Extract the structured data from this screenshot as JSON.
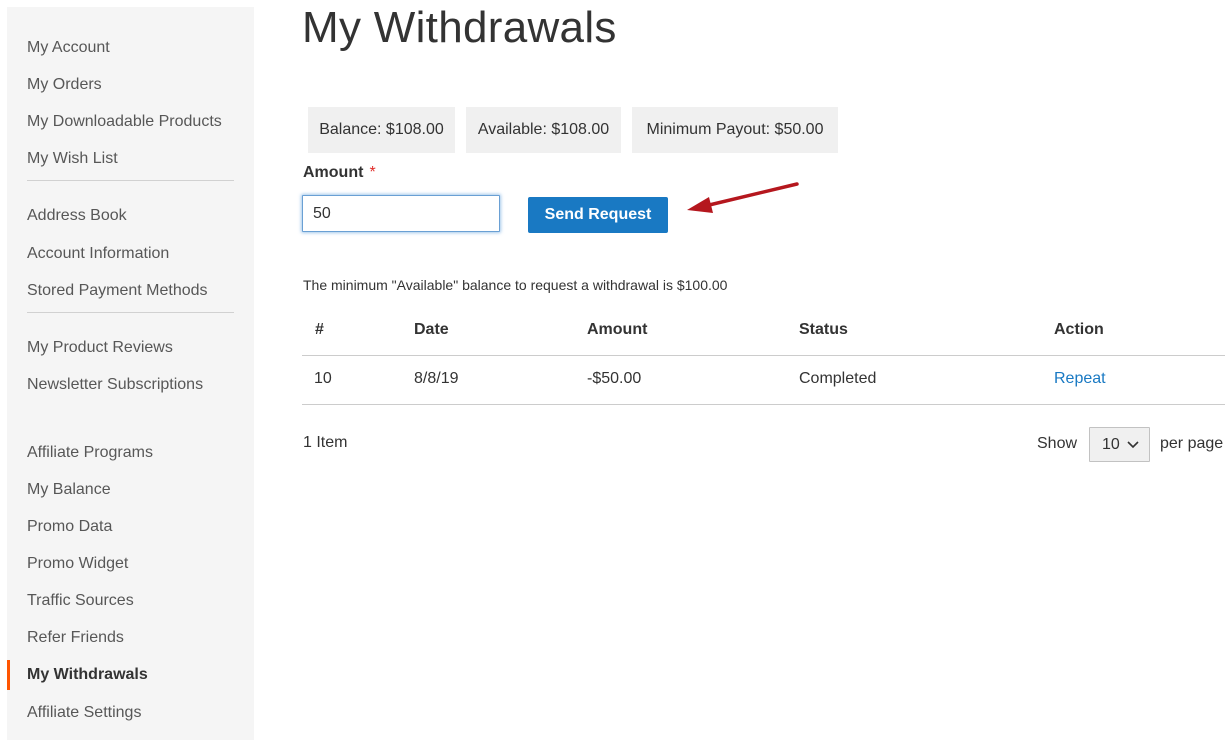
{
  "sidebar": {
    "group1": [
      "My Account",
      "My Orders",
      "My Downloadable Products",
      "My Wish List"
    ],
    "group2": [
      "Address Book",
      "Account Information",
      "Stored Payment Methods"
    ],
    "group3": [
      "My Product Reviews",
      "Newsletter Subscriptions"
    ],
    "group4": [
      "Affiliate Programs",
      "My Balance",
      "Promo Data",
      "Promo Widget",
      "Traffic Sources",
      "Refer Friends",
      "My Withdrawals",
      "Affiliate Settings"
    ],
    "current": "My Withdrawals"
  },
  "page": {
    "title": "My Withdrawals"
  },
  "stats": {
    "balance": "Balance: $108.00",
    "available": "Available: $108.00",
    "minimum_payout": "Minimum Payout: $50.00"
  },
  "form": {
    "amount_label": "Amount",
    "required_mark": "*",
    "amount_value": "50",
    "submit_label": "Send Request"
  },
  "note": "The minimum \"Available\" balance to request a withdrawal is $100.00",
  "table": {
    "headers": [
      "#",
      "Date",
      "Amount",
      "Status",
      "Action"
    ],
    "rows": [
      {
        "id": "10",
        "date": "8/8/19",
        "amount": "-$50.00",
        "status": "Completed",
        "action": "Repeat"
      }
    ]
  },
  "pager": {
    "item_count": "1 Item",
    "show_label": "Show",
    "limit_value": "10",
    "per_page_label": "per page"
  },
  "colors": {
    "accent": "#1979c3",
    "current_marker": "#ff5501",
    "arrow": "#b5171e"
  },
  "icons": {
    "select": "chevron-down-icon",
    "annotation": "red-arrow-icon"
  }
}
